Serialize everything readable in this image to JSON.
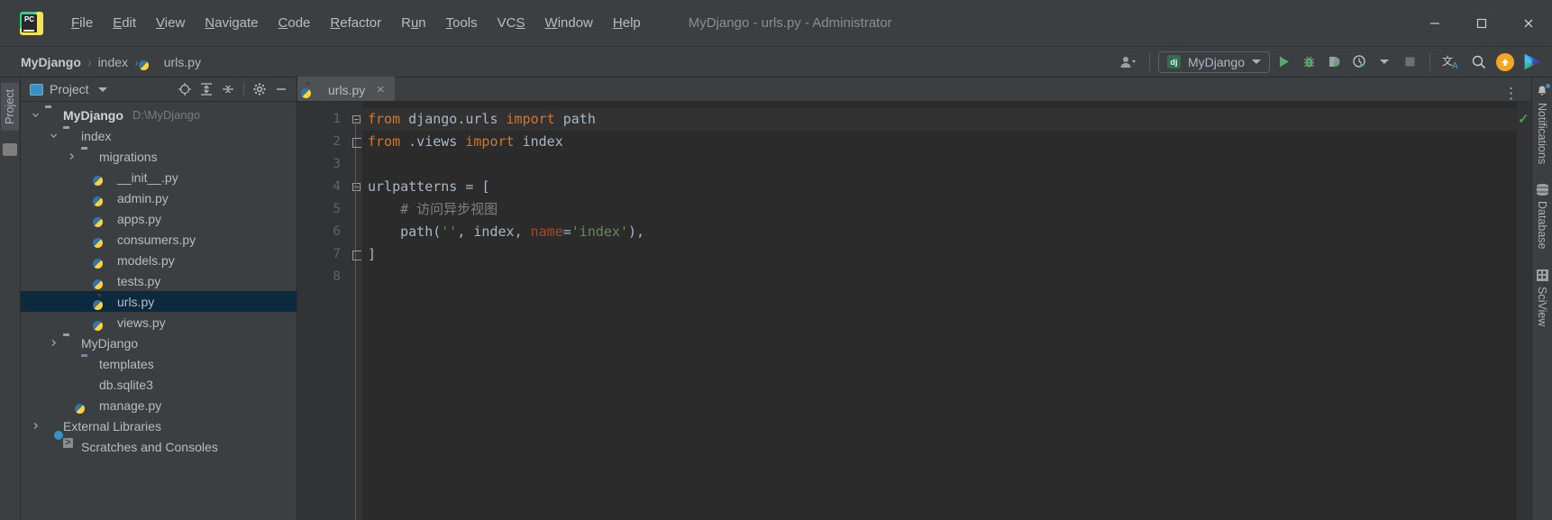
{
  "window": {
    "title": "MyDjango - urls.py - Administrator",
    "logo_text": "PC",
    "minimize_label": "Minimize",
    "maximize_label": "Maximize",
    "close_label": "Close"
  },
  "menu": {
    "items": [
      {
        "label": "File",
        "mnemonic": "F"
      },
      {
        "label": "Edit",
        "mnemonic": "E"
      },
      {
        "label": "View",
        "mnemonic": "V"
      },
      {
        "label": "Navigate",
        "mnemonic": "N"
      },
      {
        "label": "Code",
        "mnemonic": "C"
      },
      {
        "label": "Refactor",
        "mnemonic": "R"
      },
      {
        "label": "Run",
        "mnemonic": "u"
      },
      {
        "label": "Tools",
        "mnemonic": "T"
      },
      {
        "label": "VCS",
        "mnemonic": "S"
      },
      {
        "label": "Window",
        "mnemonic": "W"
      },
      {
        "label": "Help",
        "mnemonic": "H"
      }
    ]
  },
  "breadcrumb": {
    "separator": "›",
    "items": [
      {
        "label": "MyDjango",
        "icon": ""
      },
      {
        "label": "index",
        "icon": ""
      },
      {
        "label": "urls.py",
        "icon": "python-file-icon"
      }
    ]
  },
  "toolbar": {
    "profile_icon": "user-icon",
    "run_config": {
      "label": "MyDjango",
      "icon": "django-icon"
    },
    "run_label": "Run",
    "debug_label": "Debug",
    "coverage_label": "Run with Coverage",
    "profile_label": "Profile",
    "stop_label": "Stop",
    "translate_label": "Translate",
    "search_label": "Search Everywhere",
    "update_label": "Update",
    "plugin_label": "Plugin"
  },
  "project_panel": {
    "tool_tab": "Project",
    "title": "Project",
    "icons": {
      "locate": "target-icon",
      "expand_all": "expand-all-icon",
      "collapse_all": "collapse-all-icon",
      "settings": "gear-icon",
      "hide": "minimize-icon"
    },
    "tree": [
      {
        "label": "MyDjango",
        "sub": "D:\\MyDjango",
        "icon": "folder-icon",
        "indent": 0,
        "arrow": "down",
        "bold": true,
        "selected": false
      },
      {
        "label": "index",
        "sub": "",
        "icon": "source-folder-icon",
        "indent": 1,
        "arrow": "down",
        "bold": false,
        "selected": false
      },
      {
        "label": "migrations",
        "sub": "",
        "icon": "source-folder-icon",
        "indent": 2,
        "arrow": "right",
        "bold": false,
        "selected": false
      },
      {
        "label": "__init__.py",
        "sub": "",
        "icon": "python-file-icon",
        "indent": 3,
        "arrow": "none",
        "bold": false,
        "selected": false
      },
      {
        "label": "admin.py",
        "sub": "",
        "icon": "python-file-icon",
        "indent": 3,
        "arrow": "none",
        "bold": false,
        "selected": false
      },
      {
        "label": "apps.py",
        "sub": "",
        "icon": "python-file-icon",
        "indent": 3,
        "arrow": "none",
        "bold": false,
        "selected": false
      },
      {
        "label": "consumers.py",
        "sub": "",
        "icon": "python-file-icon",
        "indent": 3,
        "arrow": "none",
        "bold": false,
        "selected": false
      },
      {
        "label": "models.py",
        "sub": "",
        "icon": "python-file-icon",
        "indent": 3,
        "arrow": "none",
        "bold": false,
        "selected": false
      },
      {
        "label": "tests.py",
        "sub": "",
        "icon": "python-file-icon",
        "indent": 3,
        "arrow": "none",
        "bold": false,
        "selected": false
      },
      {
        "label": "urls.py",
        "sub": "",
        "icon": "python-file-icon",
        "indent": 3,
        "arrow": "none",
        "bold": false,
        "selected": true
      },
      {
        "label": "views.py",
        "sub": "",
        "icon": "python-file-icon",
        "indent": 3,
        "arrow": "none",
        "bold": false,
        "selected": false
      },
      {
        "label": "MyDjango",
        "sub": "",
        "icon": "source-folder-icon",
        "indent": 1,
        "arrow": "right",
        "bold": false,
        "selected": false
      },
      {
        "label": "templates",
        "sub": "",
        "icon": "templates-folder-icon",
        "indent": 2,
        "arrow": "none",
        "bold": false,
        "selected": false
      },
      {
        "label": "db.sqlite3",
        "sub": "",
        "icon": "database-file-icon",
        "indent": 2,
        "arrow": "none",
        "bold": false,
        "selected": false
      },
      {
        "label": "manage.py",
        "sub": "",
        "icon": "python-file-icon",
        "indent": 2,
        "arrow": "none",
        "bold": false,
        "selected": false
      },
      {
        "label": "External Libraries",
        "sub": "",
        "icon": "libraries-icon",
        "indent": 0,
        "arrow": "right",
        "bold": false,
        "selected": false
      },
      {
        "label": "Scratches and Consoles",
        "sub": "",
        "icon": "scratches-icon",
        "indent": 1,
        "arrow": "none",
        "bold": false,
        "selected": false
      }
    ]
  },
  "editor": {
    "tabs": [
      {
        "label": "urls.py",
        "icon": "python-file-icon",
        "active": true,
        "close": "×"
      }
    ],
    "options_icon": "kebab-menu-icon",
    "inspection_status": "✓",
    "line_numbers": [
      "1",
      "2",
      "3",
      "4",
      "5",
      "6",
      "7",
      "8"
    ],
    "lines": [
      {
        "n": 1,
        "fold": "minus",
        "highlight": true,
        "tokens": [
          {
            "t": "from ",
            "c": "kw"
          },
          {
            "t": "django.urls ",
            "c": "id"
          },
          {
            "t": "import ",
            "c": "kw"
          },
          {
            "t": "path",
            "c": "id"
          }
        ]
      },
      {
        "n": 2,
        "fold": "end",
        "highlight": false,
        "tokens": [
          {
            "t": "from ",
            "c": "kw"
          },
          {
            "t": ".views ",
            "c": "id"
          },
          {
            "t": "import ",
            "c": "kw"
          },
          {
            "t": "index",
            "c": "id"
          }
        ]
      },
      {
        "n": 3,
        "fold": "none",
        "highlight": false,
        "tokens": []
      },
      {
        "n": 4,
        "fold": "minus",
        "highlight": false,
        "tokens": [
          {
            "t": "urlpatterns ",
            "c": "id"
          },
          {
            "t": "= ",
            "c": "pn"
          },
          {
            "t": "[",
            "c": "pn"
          }
        ]
      },
      {
        "n": 5,
        "fold": "none",
        "highlight": false,
        "tokens": [
          {
            "t": "    # 访问异步视图",
            "c": "cm"
          }
        ]
      },
      {
        "n": 6,
        "fold": "none",
        "highlight": false,
        "tokens": [
          {
            "t": "    path",
            "c": "fn"
          },
          {
            "t": "(",
            "c": "pn"
          },
          {
            "t": "''",
            "c": "str"
          },
          {
            "t": ", ",
            "c": "pn"
          },
          {
            "t": "index",
            "c": "id"
          },
          {
            "t": ", ",
            "c": "pn"
          },
          {
            "t": "name",
            "c": "kwarg"
          },
          {
            "t": "=",
            "c": "pn"
          },
          {
            "t": "'index'",
            "c": "str"
          },
          {
            "t": "),",
            "c": "pn"
          }
        ]
      },
      {
        "n": 7,
        "fold": "end",
        "highlight": false,
        "tokens": [
          {
            "t": "]",
            "c": "pn"
          }
        ]
      },
      {
        "n": 8,
        "fold": "none",
        "highlight": false,
        "tokens": []
      }
    ]
  },
  "right_sidebar": {
    "tabs": [
      {
        "label": "Notifications",
        "icon": "bell-icon",
        "badge": true
      },
      {
        "label": "Database",
        "icon": "database-icon",
        "badge": false
      },
      {
        "label": "SciView",
        "icon": "grid-icon",
        "badge": false
      }
    ]
  },
  "colors": {
    "accent_blue": "#3592c4",
    "selection": "#0d293e",
    "keyword": "#cc7832",
    "string": "#6a8759",
    "comment": "#808080",
    "kwarg": "#aa4926",
    "run_green": "#59a869",
    "bg_panel": "#3c3f41",
    "bg_editor": "#2b2b2b"
  }
}
